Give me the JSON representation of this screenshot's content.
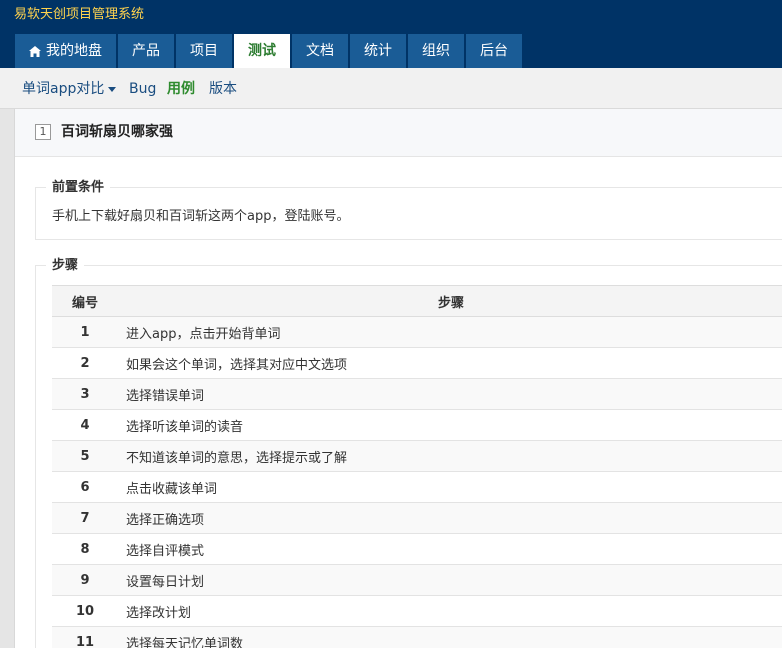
{
  "app": {
    "title": "易软天创项目管理系统"
  },
  "nav": {
    "tabs": [
      {
        "label": "我的地盘",
        "icon": "home-icon"
      },
      {
        "label": "产品"
      },
      {
        "label": "项目"
      },
      {
        "label": "测试",
        "active": true
      },
      {
        "label": "文档"
      },
      {
        "label": "统计"
      },
      {
        "label": "组织"
      },
      {
        "label": "后台"
      }
    ]
  },
  "subnav": {
    "product": "单词app对比",
    "bug": "Bug",
    "case": "用例",
    "version": "版本"
  },
  "testcase": {
    "id": "1",
    "title": "百词斩扇贝哪家强"
  },
  "precondition": {
    "legend": "前置条件",
    "text": "手机上下载好扇贝和百词斩这两个app，登陆账号。"
  },
  "steps": {
    "legend": "步骤",
    "headers": {
      "no": "编号",
      "step": "步骤"
    },
    "rows": [
      {
        "no": "1",
        "step": "进入app，点击开始背单词"
      },
      {
        "no": "2",
        "step": "如果会这个单词，选择其对应中文选项"
      },
      {
        "no": "3",
        "step": "选择错误单词"
      },
      {
        "no": "4",
        "step": "选择听该单词的读音"
      },
      {
        "no": "5",
        "step": "不知道该单词的意思，选择提示或了解"
      },
      {
        "no": "6",
        "step": "点击收藏该单词"
      },
      {
        "no": "7",
        "step": "选择正确选项"
      },
      {
        "no": "8",
        "step": "选择自评模式"
      },
      {
        "no": "9",
        "step": "设置每日计划"
      },
      {
        "no": "10",
        "step": "选择改计划"
      },
      {
        "no": "11",
        "step": "选择每天记忆单词数"
      }
    ]
  },
  "colors": {
    "header_bg": "#003366",
    "title_text": "#ffd34e",
    "tab_bg": "#1a5c96",
    "active_tab_text": "#2e7d32"
  }
}
